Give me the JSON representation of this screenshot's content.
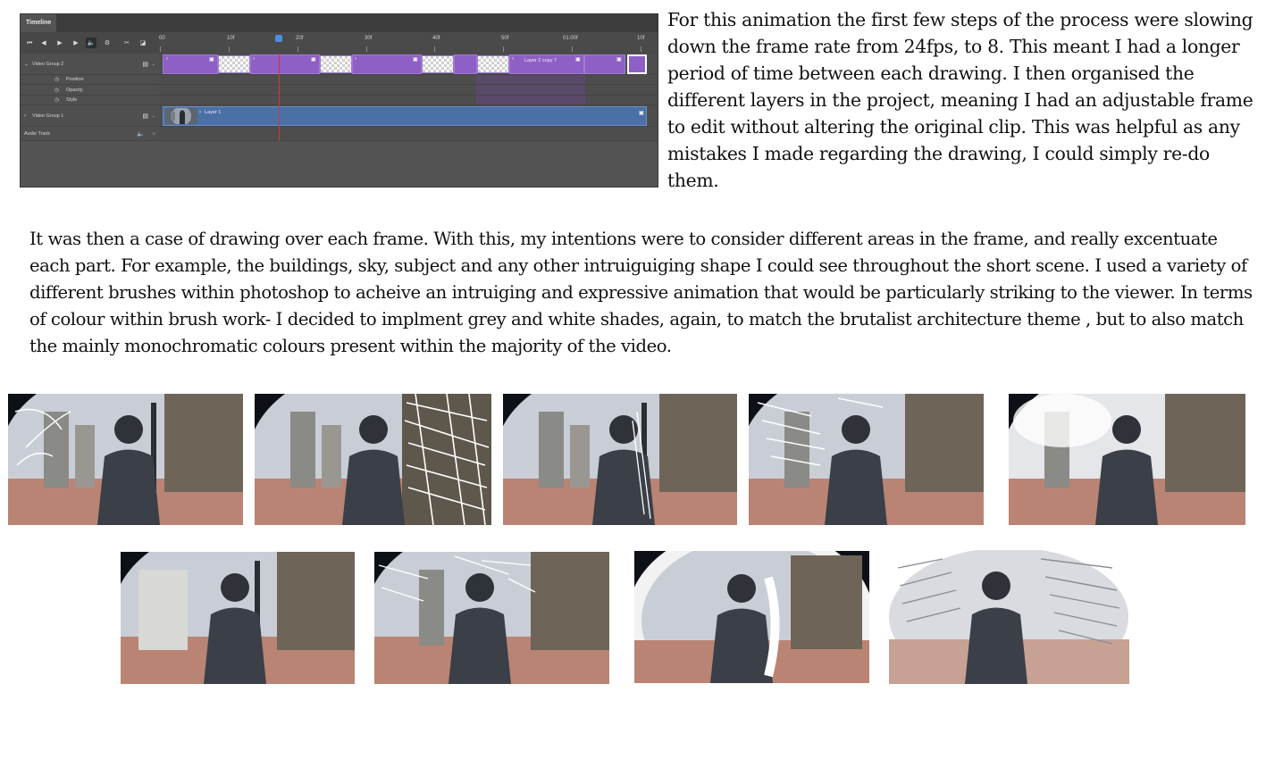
{
  "timeline": {
    "tab_title": "Timeline",
    "ruler_labels": [
      "00",
      "10f",
      "20f",
      "30f",
      "40f",
      "50f",
      "01:00f",
      "10f"
    ],
    "tracks": {
      "video_group_2": "Video Group 2",
      "position": "Position",
      "opacity": "Opacity",
      "style": "Style",
      "video_group_1": "Video Group 1",
      "audio_track": "Audio Track"
    },
    "clips": {
      "layer_2_copy_7": "Layer 2 copy 7",
      "layer_1": "Layer 1"
    },
    "controls": [
      "go-to-first-frame-icon",
      "previous-frame-icon",
      "play-icon",
      "next-frame-icon",
      "audio-icon",
      "settings-icon",
      "split-icon",
      "transition-icon"
    ],
    "colors": {
      "clip_purple": "#8e5fc4",
      "clip_blue": "#4a70a6",
      "playhead": "#e03030"
    }
  },
  "text": {
    "intro": "For this animation the first few steps of the process were slowing down the frame rate from 24fps, to 8. This meant I had a longer period of time between each drawing. I then organised the different layers in the project, meaning I had an adjustable frame to edit without altering the original clip. This was helpful as any mistakes I made regarding the drawing, I could simply re-do them.",
    "body": "It was then a case of drawing over each frame. With this, my intentions were to consider different areas in the frame, and really excentuate each part. For example, the buildings, sky, subject and any other intruiguiging shape I could see throughout the short scene. I used a variety of different brushes within photoshop to acheive an intruiging and expressive animation that would be particularly striking to the viewer. In terms of colour within brush work- I decided to implment grey and white shades, again, to match the brutalist architecture theme , but to also match the mainly monochromatic colours present within the majority of the video."
  }
}
